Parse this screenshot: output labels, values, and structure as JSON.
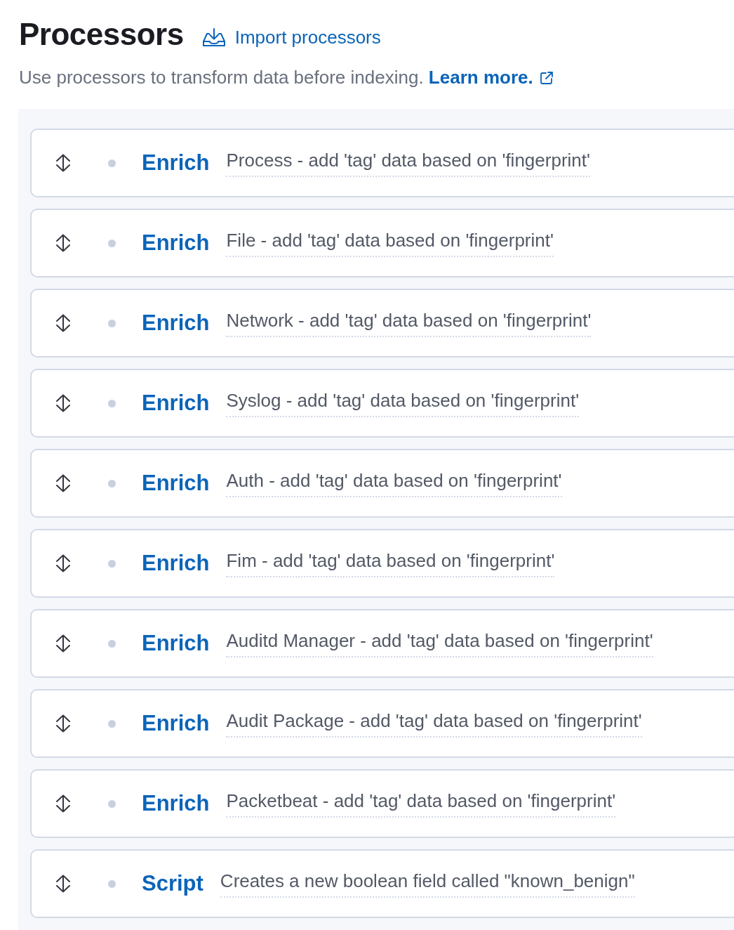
{
  "header": {
    "title": "Processors",
    "import_button": "Import processors"
  },
  "intro": {
    "text": "Use processors to transform data before indexing.",
    "link": "Learn more."
  },
  "processors": [
    {
      "type": "Enrich",
      "description": "Process - add 'tag' data based on 'fingerprint'"
    },
    {
      "type": "Enrich",
      "description": "File - add 'tag' data based on 'fingerprint'"
    },
    {
      "type": "Enrich",
      "description": "Network - add 'tag' data based on 'fingerprint'"
    },
    {
      "type": "Enrich",
      "description": "Syslog - add 'tag' data based on 'fingerprint'"
    },
    {
      "type": "Enrich",
      "description": "Auth - add 'tag' data based on 'fingerprint'"
    },
    {
      "type": "Enrich",
      "description": "Fim - add 'tag' data based on 'fingerprint'"
    },
    {
      "type": "Enrich",
      "description": "Auditd Manager - add 'tag' data based on 'fingerprint'"
    },
    {
      "type": "Enrich",
      "description": "Audit Package - add 'tag' data based on 'fingerprint'"
    },
    {
      "type": "Enrich",
      "description": "Packetbeat - add 'tag' data based on 'fingerprint'"
    },
    {
      "type": "Script",
      "description": "Creates a new boolean field called \"known_benign\""
    }
  ]
}
